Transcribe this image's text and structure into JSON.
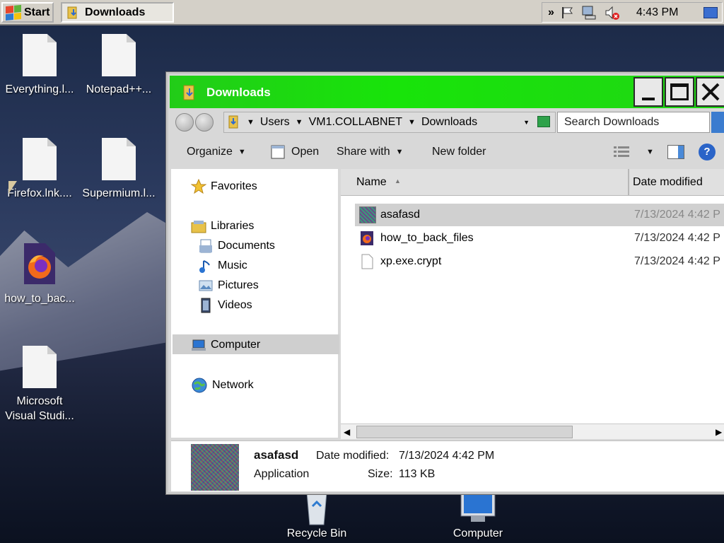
{
  "taskbar": {
    "start_label": "Start",
    "active_task": "Downloads",
    "clock": "4:43 PM"
  },
  "desktop_icons": [
    {
      "label": "Everything.l..."
    },
    {
      "label": "Notepad++..."
    },
    {
      "label": "Firefox.lnk...."
    },
    {
      "label": "Supermium.l..."
    },
    {
      "label": "how_to_bac..."
    },
    {
      "label_line1": "Microsoft",
      "label_line2": "Visual Studi..."
    }
  ],
  "bottom_icons": [
    {
      "label": "Recycle Bin"
    },
    {
      "label": "Computer"
    }
  ],
  "window": {
    "title": "Downloads",
    "breadcrumb": [
      "Users",
      "VM1.COLLABNET",
      "Downloads"
    ],
    "search_placeholder": "Search Downloads",
    "toolbar": {
      "organize": "Organize",
      "open": "Open",
      "share_with": "Share with",
      "new_folder": "New folder"
    },
    "nav": {
      "favorites": "Favorites",
      "libraries": "Libraries",
      "documents": "Documents",
      "music": "Music",
      "pictures": "Pictures",
      "videos": "Videos",
      "computer": "Computer",
      "network": "Network"
    },
    "columns": {
      "name": "Name",
      "date_modified": "Date modified"
    },
    "files": [
      {
        "name": "asafasd",
        "date": "7/13/2024 4:42 P",
        "selected": true
      },
      {
        "name": "how_to_back_files",
        "date": "7/13/2024 4:42 P",
        "selected": false
      },
      {
        "name": "xp.exe.crypt",
        "date": "7/13/2024 4:42 P",
        "selected": false
      }
    ],
    "details": {
      "name": "asafasd",
      "type": "Application",
      "date_label": "Date modified:",
      "date_value": "7/13/2024 4:42 PM",
      "size_label": "Size:",
      "size_value": "113 KB"
    }
  },
  "colors": {
    "titlebar": "#18e40a",
    "taskbar": "#d4d0c8",
    "selection": "#d0d0d0"
  }
}
